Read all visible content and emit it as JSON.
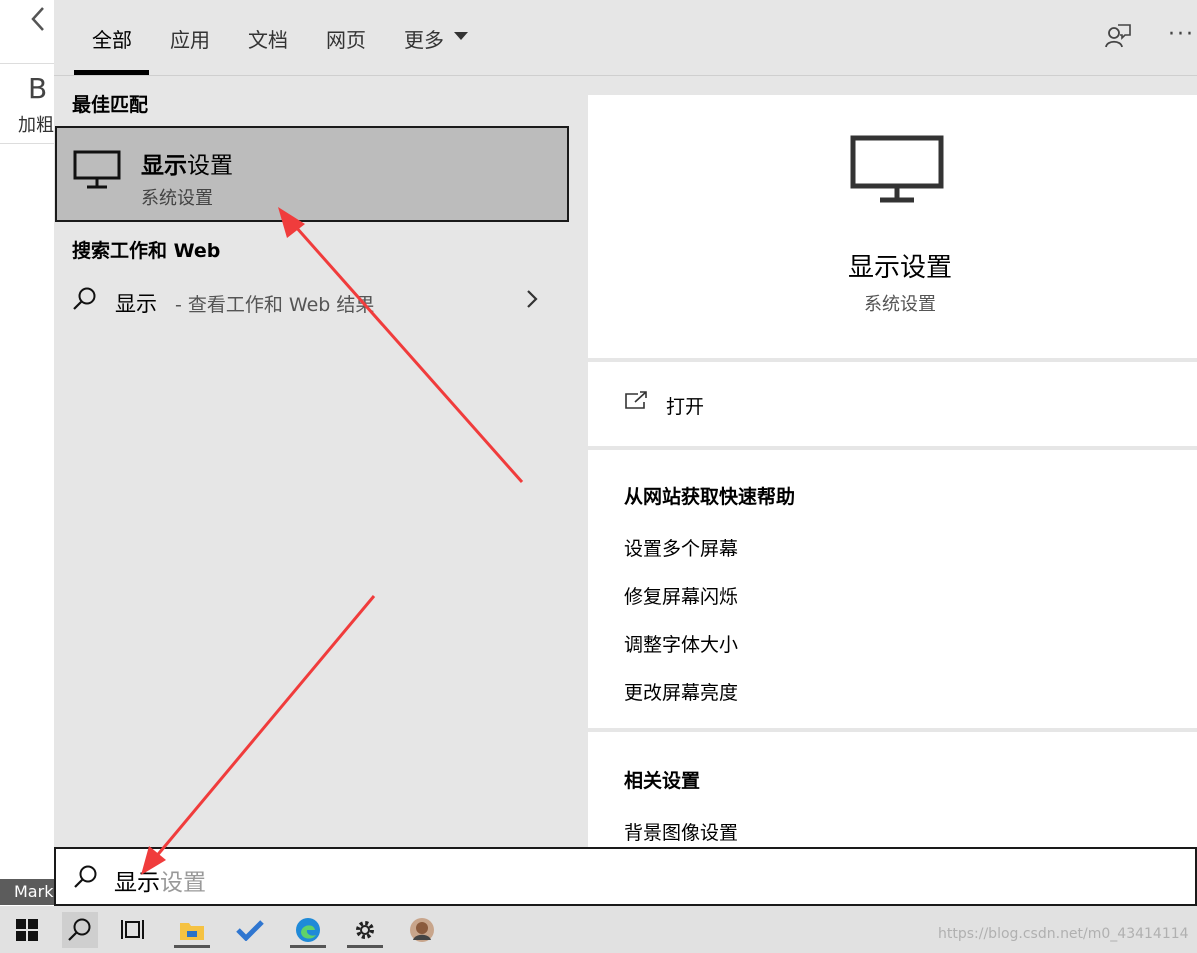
{
  "background_app": {
    "back_glyph": "‹",
    "bold_icon_text": "B",
    "bold_label": "加粗",
    "mark_label": "Mark"
  },
  "tabs": {
    "all": "全部",
    "apps": "应用",
    "docs": "文档",
    "web": "网页",
    "more": "更多",
    "more_dots": "···"
  },
  "results": {
    "best_match_heading": "最佳匹配",
    "best_item": {
      "title_bold": "显示",
      "title_rest": "设置",
      "subtitle": "系统设置",
      "icon": "monitor-icon"
    },
    "web_heading": "搜索工作和 Web",
    "web_item": {
      "query": "显示",
      "hint": "- 查看工作和 Web 结果",
      "icon": "search-icon"
    }
  },
  "detail": {
    "title": "显示设置",
    "subtitle": "系统设置",
    "open_label": "打开",
    "help_heading": "从网站获取快速帮助",
    "help_links": [
      "设置多个屏幕",
      "修复屏幕闪烁",
      "调整字体大小",
      "更改屏幕亮度"
    ],
    "related_heading": "相关设置",
    "related_link": "背景图像设置"
  },
  "search_box": {
    "typed": "显示",
    "suggestion": "设置"
  },
  "taskbar": {
    "watermark": "https://blog.csdn.net/m0_43414114",
    "icons": [
      "windows-start-icon",
      "search-icon",
      "task-view-icon",
      "file-explorer-icon",
      "todo-icon",
      "edge-icon",
      "settings-icon",
      "user-avatar-icon"
    ]
  },
  "colors": {
    "panel_bg": "#e6e6e6",
    "selected_bg": "#bcbcbc",
    "annotation_red": "#f03c3c"
  }
}
